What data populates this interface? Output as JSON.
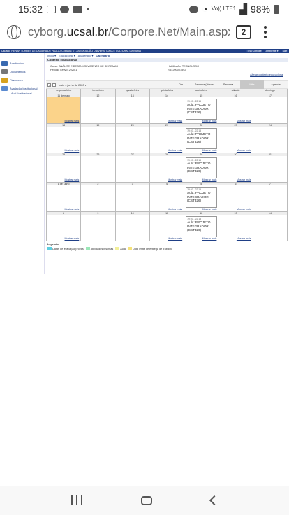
{
  "status_bar": {
    "time": "15:32",
    "notification_icons": [
      "mail-icon",
      "facebook-icon",
      "linkedin-icon"
    ],
    "right_icons": [
      "alarm-icon",
      "wifi-icon",
      "volte-icon",
      "signal-icon"
    ],
    "volte_label": "Vo)) LTE1",
    "battery": "98%"
  },
  "browser": {
    "url_prefix": "cyborg.",
    "url_domain": "ucsal.br",
    "url_path": "/Corpore.Net/Main.aspx?",
    "tab_count": "2"
  },
  "portal": {
    "top_user_text": "Usuário: RENAN TORRES DE CAMARA DE PAULA | Coligada: 2 - ASSOCIAÇÃO UNIVERSITÁRIA E CULTURAL DA BAHIA",
    "top_links": [
      "Tela Corpore",
      "Ambiente ▾",
      "Sair"
    ],
    "sidebar": {
      "items": [
        {
          "label": "Acadêmico",
          "icon": "academic-icon",
          "color": "#3a6ab0"
        },
        {
          "label": "Documentos",
          "icon": "documents-icon",
          "color": "#777777"
        },
        {
          "label": "Financeiro",
          "icon": "financial-icon",
          "color": "#d7a21f"
        },
        {
          "label": "Avaliação Institucional",
          "icon": "evaluation-icon",
          "color": "#5a8ad0"
        }
      ],
      "subitem": "Aval. Institucional"
    },
    "breadcrumb": [
      "Início ▾",
      "Educacional ▾",
      "Acadêmico ▾",
      "Calendário"
    ],
    "context": {
      "title": "Contexto Educacional",
      "curso": "Curso: ANÁLISE E DESENVOLVIMENTO DE SISTEMAS",
      "periodo": "Período Letivo: 2020/1",
      "habilitacao": "Habilitação: TECNOLOGO",
      "ra": "RA: 200001592",
      "change_link": "Alterar contexto educacional"
    },
    "calendar": {
      "range_label": "maio – junho de 2020 ▾",
      "views": [
        "Dia",
        "Semana (Horas)",
        "Semana",
        "Mês",
        "Agenda"
      ],
      "selected_view": "Mês",
      "weekdays": [
        "segunda-feira",
        "terça-feira",
        "quarta-feira",
        "quinta-feira",
        "sexta-feira",
        "sábado",
        "domingo"
      ],
      "more_label": "Mostrar mais",
      "weeks": [
        {
          "days": [
            "11 de maio",
            "12",
            "13",
            "14",
            "15",
            "16",
            "17"
          ],
          "more": [
            0,
            3,
            4,
            5
          ]
        },
        {
          "days": [
            "18",
            "19",
            "20",
            "21",
            "22",
            "23",
            "24"
          ],
          "more": [
            0,
            3,
            4,
            5
          ]
        },
        {
          "days": [
            "25",
            "26",
            "27",
            "28",
            "29",
            "30",
            "31"
          ],
          "more": [
            0,
            3,
            4,
            5
          ]
        },
        {
          "days": [
            "1 de junho",
            "2",
            "3",
            "4",
            "5",
            "6",
            "7"
          ],
          "more": [
            0,
            3,
            4,
            5
          ]
        },
        {
          "days": [
            "8",
            "9",
            "10",
            "11",
            "12",
            "13",
            "14"
          ],
          "more": [
            0,
            3,
            4,
            5
          ]
        }
      ],
      "event": {
        "time": "19:00 - 22:15",
        "line1": "Aula: PROJETO",
        "line2": "INTEGRADOR",
        "line3": "(CST326)"
      },
      "today_color": "#fbd38a"
    },
    "legend": {
      "title": "Legenda",
      "items": [
        {
          "label": "Datas de avaliação/provas",
          "color": "#5ecfe0"
        },
        {
          "label": "Atividades inscritas",
          "color": "#9be7b8"
        },
        {
          "label": "Aula",
          "color": "#f2ef9a"
        },
        {
          "label": "Data limite de entrega de trabalho",
          "color": "#f5e27a"
        }
      ]
    }
  }
}
